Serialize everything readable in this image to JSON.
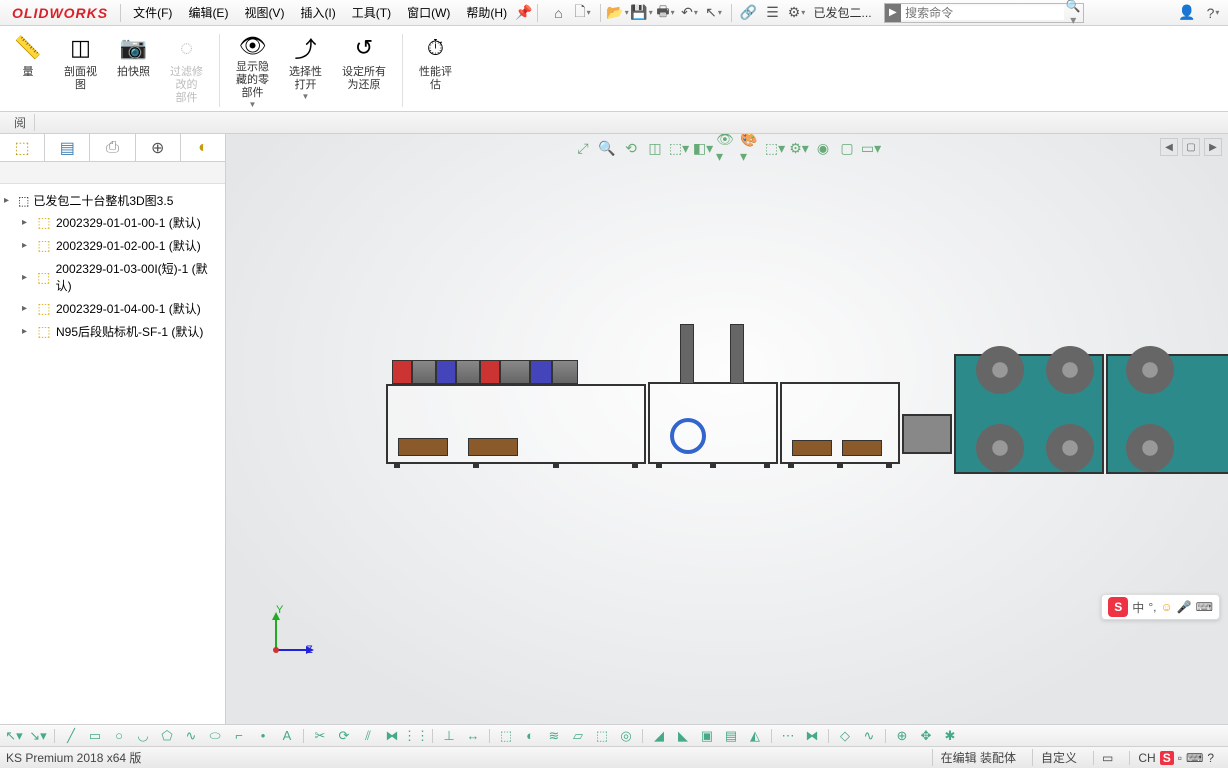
{
  "app": {
    "logo": "OLIDWORKS"
  },
  "menu": {
    "file": "文件(F)",
    "edit": "编辑(E)",
    "view": "视图(V)",
    "insert": "插入(I)",
    "tools": "工具(T)",
    "window": "窗口(W)",
    "help": "帮助(H)"
  },
  "doc_title": "已发包二...",
  "search": {
    "placeholder": "搜索命令"
  },
  "ribbon": {
    "measure": "量",
    "section_view": "剖面视\n图",
    "snapshot": "拍快照",
    "filter_modified": "过滤修\n改的\n部件",
    "show_hidden": "显示隐\n藏的零\n部件",
    "open_selection": "选择性\n打开",
    "restore_all": "设定所有\n为还原",
    "performance": "性能评\n估"
  },
  "tabstrip": {
    "label": "阅"
  },
  "tree": {
    "root": "已发包二十台整机3D图3.5",
    "items": [
      "2002329-01-01-00-1 (默认)",
      "2002329-01-02-00-1 (默认)",
      "2002329-01-03-00I(短)-1 (默认)",
      "2002329-01-04-00-1 (默认)",
      "N95后段贴标机-SF-1 (默认)"
    ]
  },
  "triad": {
    "y": "Y",
    "z": "Z"
  },
  "ime": {
    "label": "中"
  },
  "status": {
    "version": "KS Premium 2018 x64 版",
    "editing": "在编辑 装配体",
    "custom": "自定义",
    "lang": "CH"
  }
}
